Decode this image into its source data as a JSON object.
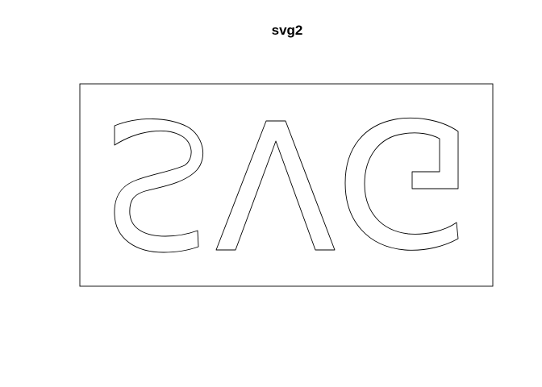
{
  "title": "svg2",
  "colors": {
    "background": "#ffffff",
    "stroke": "#000000"
  },
  "glyphs": [
    "S",
    "V",
    "G"
  ],
  "mirrored": true
}
